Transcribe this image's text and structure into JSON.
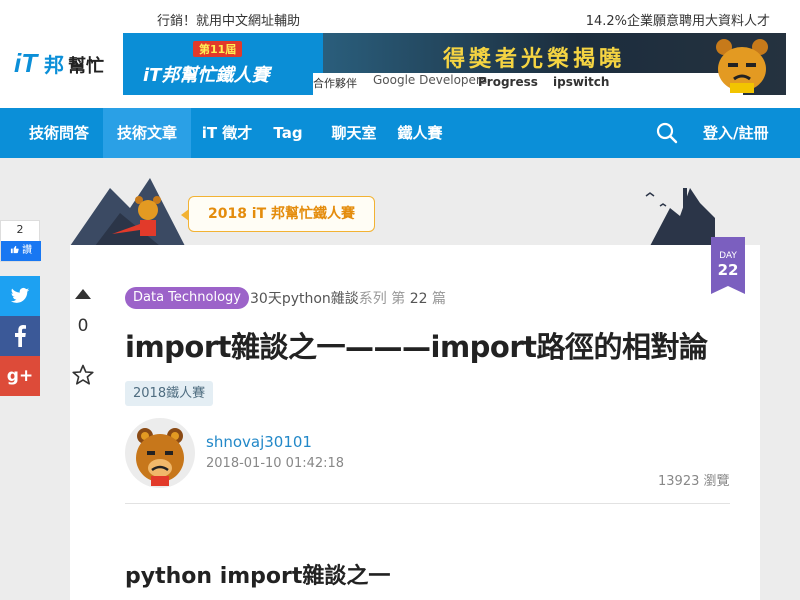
{
  "promo": {
    "left": "行銷！就用中文網址輔助",
    "right": "14.2%企業願意聘用大資料人才"
  },
  "logo": {
    "text": "iT邦幫忙"
  },
  "banner": {
    "edition": "第11屆",
    "title": "iT邦幫忙鐵人賽",
    "headline": "得獎者光榮揭曉",
    "sponsor_label": "合作夥伴",
    "sponsors": [
      "Google Developers",
      "Progress",
      "ipswitch"
    ]
  },
  "nav": {
    "items": [
      "技術問答",
      "技術文章",
      "iT 徵才",
      "Tag",
      "聊天室",
      "鐵人賽"
    ],
    "active": "技術文章",
    "login": "登入/註冊"
  },
  "ironman": {
    "label": "2018 iT 邦幫忙鐵人賽"
  },
  "day": {
    "label": "DAY",
    "number": "22"
  },
  "vote": {
    "count": "0"
  },
  "article": {
    "category": "Data Technology",
    "series_name": "30天python雜談",
    "series_word": "系列",
    "series_ordinal_prefix": "第",
    "series_number": "22",
    "series_ordinal_suffix": "篇",
    "title": "import雜談之一———import路徑的相對論",
    "tag": "2018鐵人賽",
    "author": "shnovaj30101",
    "date": "2018-01-10 01:42:18",
    "views": "13923 瀏覽",
    "heading": "python import雜談之一"
  },
  "share": {
    "like_count": "2",
    "like_label": "讚",
    "twitter_icon": "twitter-icon",
    "facebook_icon": "facebook-icon",
    "googleplus_label": "g+"
  },
  "colors": {
    "nav_bg": "#0b8fd8",
    "nav_active": "#2aa0e6",
    "category_tag": "#9c63c9",
    "day_ribbon": "#7b5fbf",
    "ironman_accent": "#e48c0c",
    "link": "#2288c8"
  }
}
